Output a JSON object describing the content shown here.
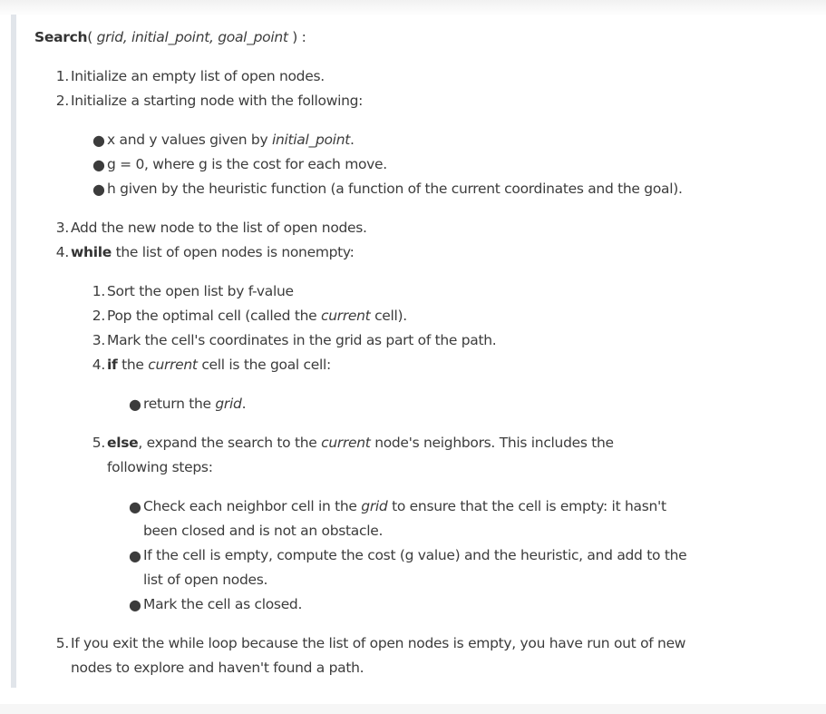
{
  "signature": {
    "name": "Search",
    "open": "( ",
    "args": "grid, initial_point, goal_point",
    "close": " ) :"
  },
  "steps": {
    "s1": {
      "num": "1.",
      "text": "Initialize an empty list of open nodes."
    },
    "s2": {
      "num": "2.",
      "text": "Initialize a starting node with the following:"
    },
    "s2_bullets": {
      "b1": {
        "pre": "x and y values given by ",
        "em": "initial_point",
        "post": "."
      },
      "b2": {
        "text": "g = 0, where g is the cost for each move."
      },
      "b3": {
        "text": "h given by the heuristic function (a function of the current coordinates and the goal)."
      }
    },
    "s3": {
      "num": "3.",
      "text": "Add the new node to the list of open nodes."
    },
    "s4": {
      "num": "4.",
      "kw": "while",
      "text": " the list of open nodes is nonempty:"
    },
    "s4_sub": {
      "i1": {
        "num": "1.",
        "text": "Sort the open list by f-value"
      },
      "i2": {
        "num": "2.",
        "pre": "Pop the optimal cell (called the ",
        "em": "current",
        "post": " cell)."
      },
      "i3": {
        "num": "3.",
        "text": "Mark the cell's coordinates in the grid as part of the path."
      },
      "i4": {
        "num": "4.",
        "kw": "if",
        "pre": " the ",
        "em": "current",
        "post": " cell is the goal cell:"
      },
      "i4_bullet": {
        "pre": "return the ",
        "em": "grid",
        "post": "."
      },
      "i5": {
        "num": "5.",
        "kw": "else",
        "pre": ", expand the search to the ",
        "em": "current",
        "post": " node's neighbors. This includes the following steps:"
      },
      "i5_bullets": {
        "b1": {
          "pre": "Check each neighbor cell in the ",
          "em": "grid",
          "post": " to ensure that the cell is empty: it hasn't been closed and is not an obstacle."
        },
        "b2": {
          "text": "If the cell is empty, compute the cost (g value) and the heuristic, and add to the list of open nodes."
        },
        "b3": {
          "text": "Mark the cell as closed."
        }
      }
    },
    "s5": {
      "num": "5.",
      "text": "If you exit the while loop because the list of open nodes is empty, you have run out of new nodes to explore and haven't found a path."
    }
  },
  "colors": {
    "text": "#3c3c3c",
    "quote_bar": "#e1e5ea",
    "background": "#ffffff"
  }
}
